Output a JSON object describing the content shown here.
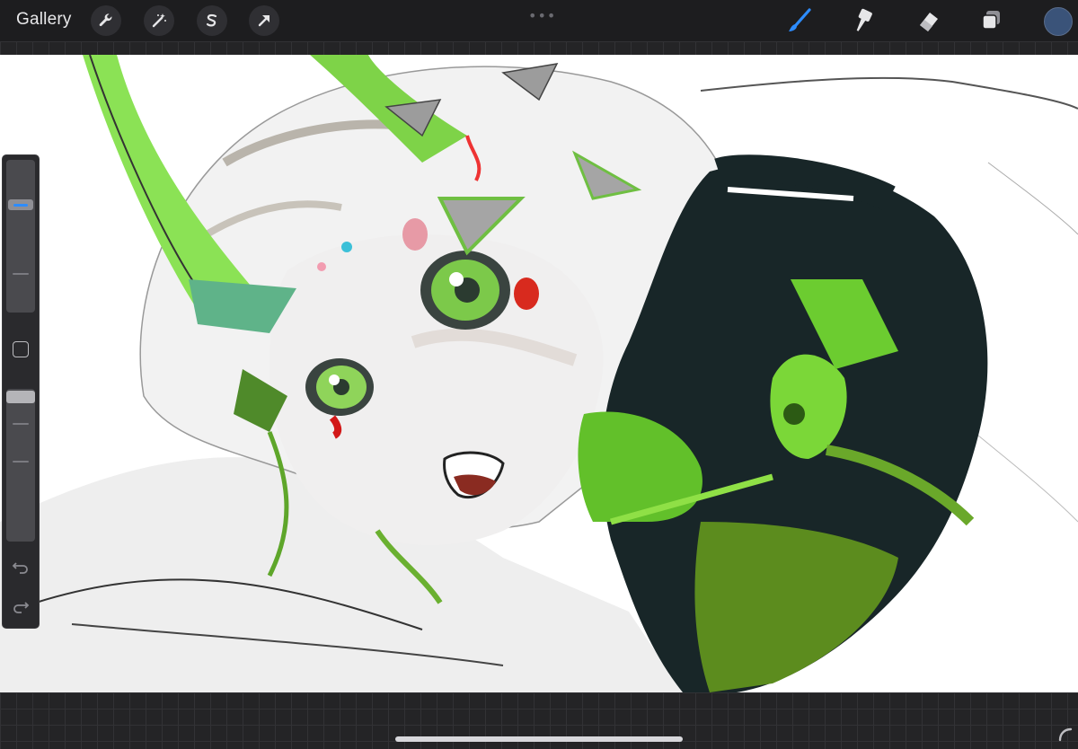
{
  "topbar": {
    "gallery_label": "Gallery",
    "left_tools": [
      "wrench-icon",
      "magic-wand-icon",
      "selection-s-icon",
      "transform-arrow-icon"
    ],
    "right_tools": [
      "brush-icon",
      "smudge-icon",
      "eraser-icon",
      "layers-icon"
    ],
    "active_tool": "brush-icon",
    "color_swatch": "#3a5379",
    "accent": "#2d8cff"
  },
  "sidebar": {
    "brush_size_level": 0.26,
    "opacity_level": 0.0
  }
}
